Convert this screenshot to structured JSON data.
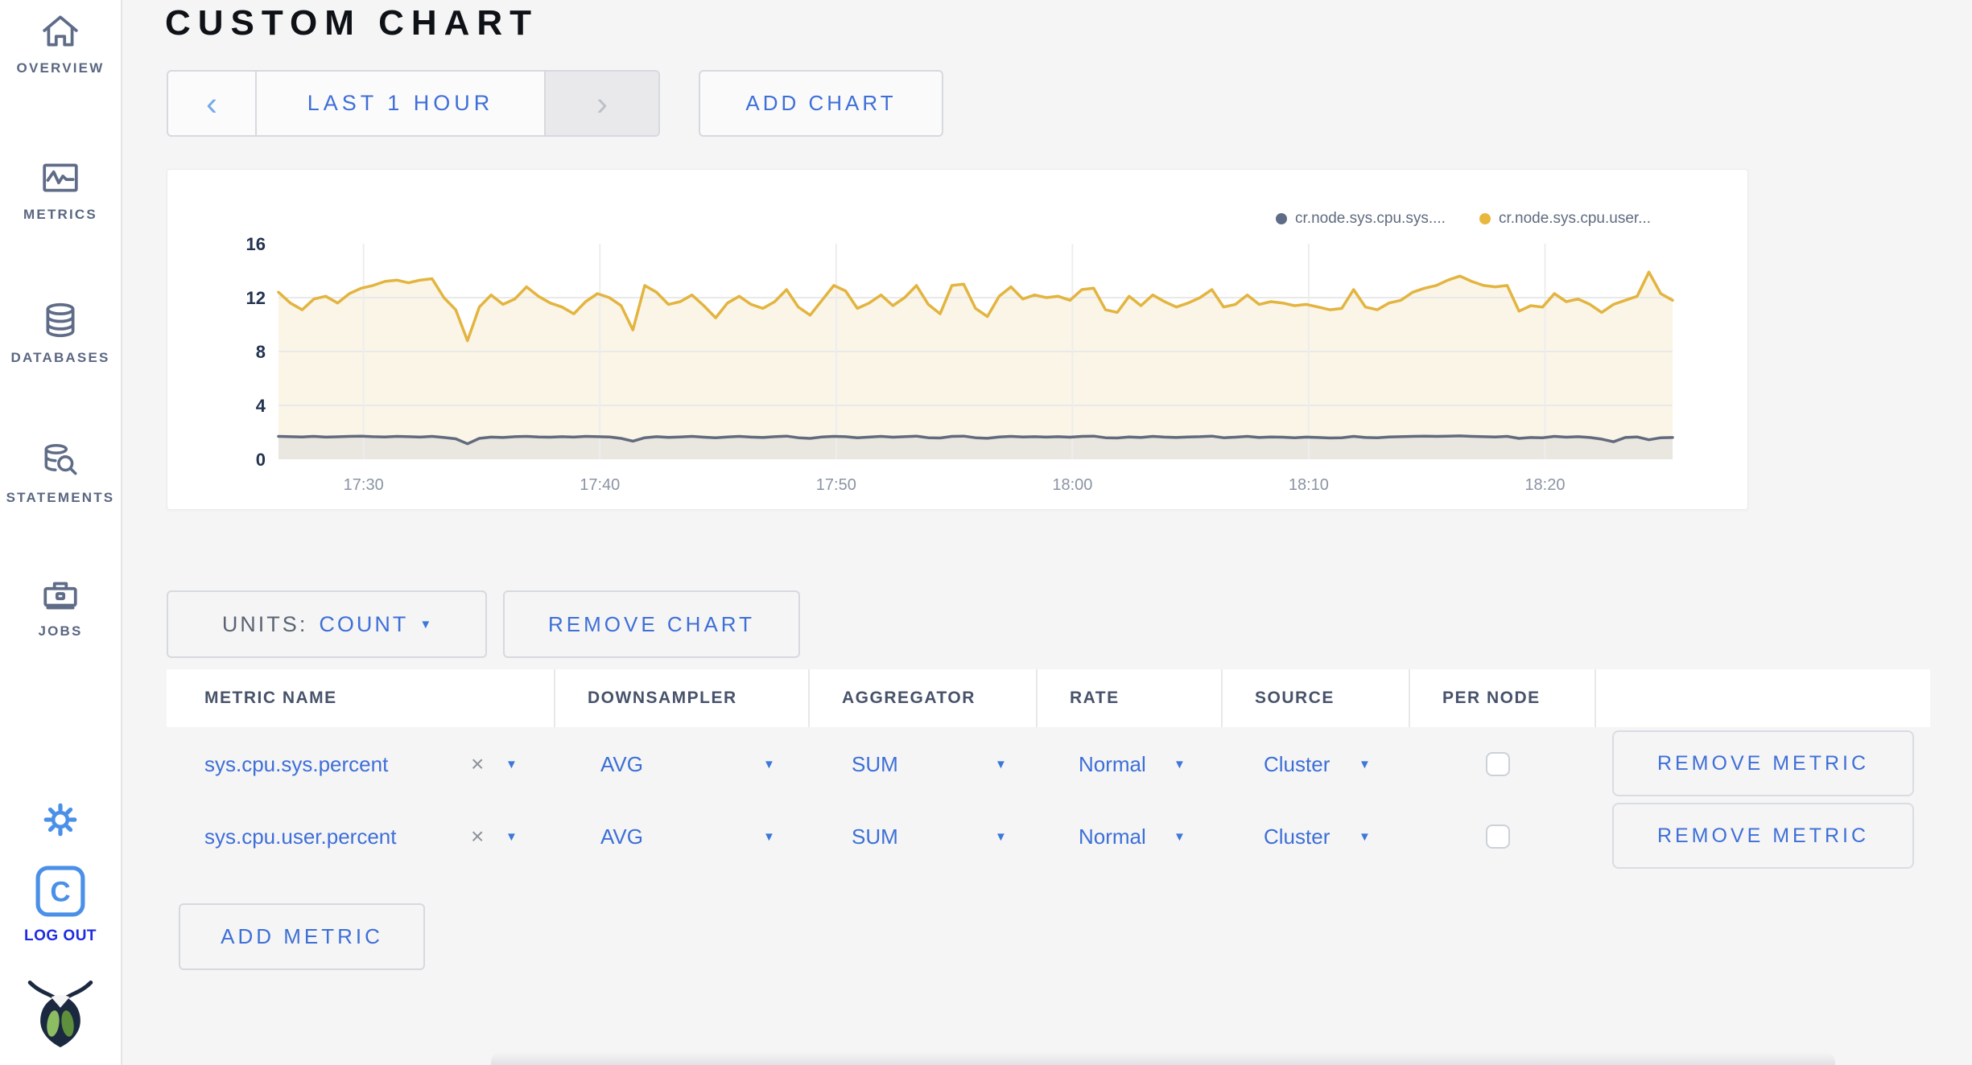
{
  "header": {
    "title": "CUSTOM CHART"
  },
  "sidebar": {
    "items": [
      {
        "label": "OVERVIEW",
        "icon": "home-icon"
      },
      {
        "label": "METRICS",
        "icon": "metrics-chart-icon"
      },
      {
        "label": "DATABASES",
        "icon": "database-icon"
      },
      {
        "label": "STATEMENTS",
        "icon": "statements-search-icon"
      },
      {
        "label": "JOBS",
        "icon": "briefcase-icon"
      }
    ],
    "settings_icon": "gear-icon",
    "logout": {
      "label": "LOG OUT",
      "icon": "cockroach-c-icon"
    },
    "logo_icon": "cockroach-bug-logo"
  },
  "toolbar": {
    "prev_arrow": "‹",
    "time_window_label": "LAST 1 HOUR",
    "next_arrow": "›",
    "add_chart_label": "ADD CHART"
  },
  "chart_controls": {
    "units_label": "UNITS:",
    "units_value": "COUNT",
    "remove_chart_label": "REMOVE CHART"
  },
  "chart_data": {
    "type": "line",
    "title": "",
    "ylim": [
      0,
      16
    ],
    "y_ticks": [
      0,
      4,
      8,
      12,
      16
    ],
    "h_gridlines": [
      4,
      8,
      12
    ],
    "x_range_minutes": [
      0,
      59
    ],
    "sample_step_minutes": 0.5,
    "x_ticks": [
      {
        "t": 3.6,
        "label": "17:30"
      },
      {
        "t": 13.6,
        "label": "17:40"
      },
      {
        "t": 23.6,
        "label": "17:50"
      },
      {
        "t": 33.6,
        "label": "18:00"
      },
      {
        "t": 43.6,
        "label": "18:10"
      },
      {
        "t": 53.6,
        "label": "18:20"
      }
    ],
    "legend": [
      {
        "name": "cr.node.sys.cpu.sys....",
        "color": "#5f6c87"
      },
      {
        "name": "cr.node.sys.cpu.user...",
        "color": "#e8b73e"
      }
    ],
    "series": [
      {
        "name": "cr.node.sys.cpu.sys....",
        "color": "#616b7d",
        "fill": "#eae7e0",
        "values": [
          1.7,
          1.68,
          1.66,
          1.7,
          1.65,
          1.67,
          1.7,
          1.72,
          1.68,
          1.66,
          1.7,
          1.68,
          1.65,
          1.7,
          1.62,
          1.52,
          1.15,
          1.55,
          1.65,
          1.62,
          1.68,
          1.7,
          1.66,
          1.64,
          1.68,
          1.65,
          1.7,
          1.68,
          1.66,
          1.55,
          1.35,
          1.6,
          1.68,
          1.63,
          1.66,
          1.7,
          1.64,
          1.6,
          1.66,
          1.7,
          1.65,
          1.62,
          1.68,
          1.72,
          1.6,
          1.55,
          1.66,
          1.7,
          1.68,
          1.6,
          1.65,
          1.7,
          1.64,
          1.68,
          1.72,
          1.6,
          1.58,
          1.7,
          1.72,
          1.6,
          1.56,
          1.66,
          1.7,
          1.66,
          1.68,
          1.65,
          1.68,
          1.64,
          1.7,
          1.72,
          1.6,
          1.58,
          1.66,
          1.62,
          1.7,
          1.65,
          1.62,
          1.66,
          1.68,
          1.72,
          1.6,
          1.64,
          1.7,
          1.62,
          1.66,
          1.64,
          1.6,
          1.65,
          1.62,
          1.58,
          1.6,
          1.7,
          1.62,
          1.6,
          1.66,
          1.68,
          1.7,
          1.72,
          1.7,
          1.72,
          1.74,
          1.7,
          1.68,
          1.66,
          1.7,
          1.55,
          1.62,
          1.6,
          1.7,
          1.64,
          1.68,
          1.62,
          1.5,
          1.3,
          1.62,
          1.66,
          1.45,
          1.6,
          1.62
        ]
      },
      {
        "name": "cr.node.sys.cpu.user...",
        "color": "#e3b43f",
        "fill": "#faf5e6",
        "values": [
          12.4,
          11.6,
          11.1,
          11.9,
          12.1,
          11.6,
          12.3,
          12.7,
          12.9,
          13.2,
          13.3,
          13.1,
          13.3,
          13.4,
          12.0,
          11.1,
          8.8,
          11.3,
          12.2,
          11.5,
          11.9,
          12.8,
          12.1,
          11.6,
          11.3,
          10.8,
          11.7,
          12.3,
          12.0,
          11.4,
          9.6,
          12.9,
          12.4,
          11.5,
          11.7,
          12.2,
          11.4,
          10.5,
          11.6,
          12.1,
          11.5,
          11.2,
          11.7,
          12.6,
          11.3,
          10.7,
          11.8,
          12.9,
          12.5,
          11.2,
          11.6,
          12.2,
          11.4,
          12.0,
          12.9,
          11.5,
          10.8,
          12.9,
          13.0,
          11.2,
          10.6,
          12.1,
          12.8,
          11.9,
          12.2,
          12.0,
          12.1,
          11.8,
          12.6,
          12.7,
          11.1,
          10.9,
          12.1,
          11.4,
          12.2,
          11.7,
          11.3,
          11.6,
          12.0,
          12.6,
          11.3,
          11.5,
          12.2,
          11.5,
          11.7,
          11.6,
          11.4,
          11.5,
          11.3,
          11.1,
          11.2,
          12.6,
          11.3,
          11.1,
          11.6,
          11.8,
          12.4,
          12.7,
          12.9,
          13.3,
          13.6,
          13.2,
          12.9,
          12.8,
          12.9,
          11.0,
          11.4,
          11.3,
          12.3,
          11.7,
          11.9,
          11.5,
          10.9,
          11.5,
          11.8,
          12.1,
          13.9,
          12.3,
          11.8
        ]
      }
    ]
  },
  "metrics_table": {
    "columns": [
      "METRIC NAME",
      "DOWNSAMPLER",
      "AGGREGATOR",
      "RATE",
      "SOURCE",
      "PER NODE",
      ""
    ],
    "rows": [
      {
        "metric": "sys.cpu.sys.percent",
        "clear": "×",
        "downsampler": "AVG",
        "aggregator": "SUM",
        "rate": "Normal",
        "source": "Cluster",
        "per_node": false,
        "remove_label": "REMOVE METRIC"
      },
      {
        "metric": "sys.cpu.user.percent",
        "clear": "×",
        "downsampler": "AVG",
        "aggregator": "SUM",
        "rate": "Normal",
        "source": "Cluster",
        "per_node": false,
        "remove_label": "REMOVE METRIC"
      }
    ],
    "add_metric_label": "ADD METRIC"
  }
}
